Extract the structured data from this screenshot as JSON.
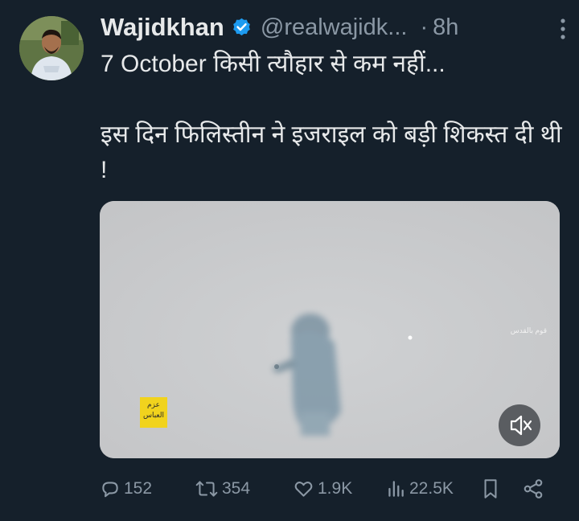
{
  "tweet": {
    "author_name": "Wajidkhan",
    "handle": "@realwajidk...",
    "separator": "·",
    "time": "8h",
    "text_line1": "7 October किसी त्यौहार से कम नहीं...",
    "text_line2": "इस दिन फिलिस्तीन ने इजराइल को बड़ी शिकस्त दी थी !"
  },
  "media": {
    "sticker_text": "عزم العباس",
    "watermark_text": "قوم بالقدس"
  },
  "actions": {
    "replies": "152",
    "retweets": "354",
    "likes": "1.9K",
    "views": "22.5K"
  },
  "colors": {
    "background": "#15202b",
    "primary_text": "#e7e9ea",
    "secondary_text": "#8b98a5",
    "verified_badge": "#1d9bf0"
  },
  "icons": [
    "verified-badge-icon",
    "more-icon",
    "mute-icon",
    "reply-icon",
    "retweet-icon",
    "like-icon",
    "views-icon",
    "bookmark-icon",
    "share-icon"
  ]
}
